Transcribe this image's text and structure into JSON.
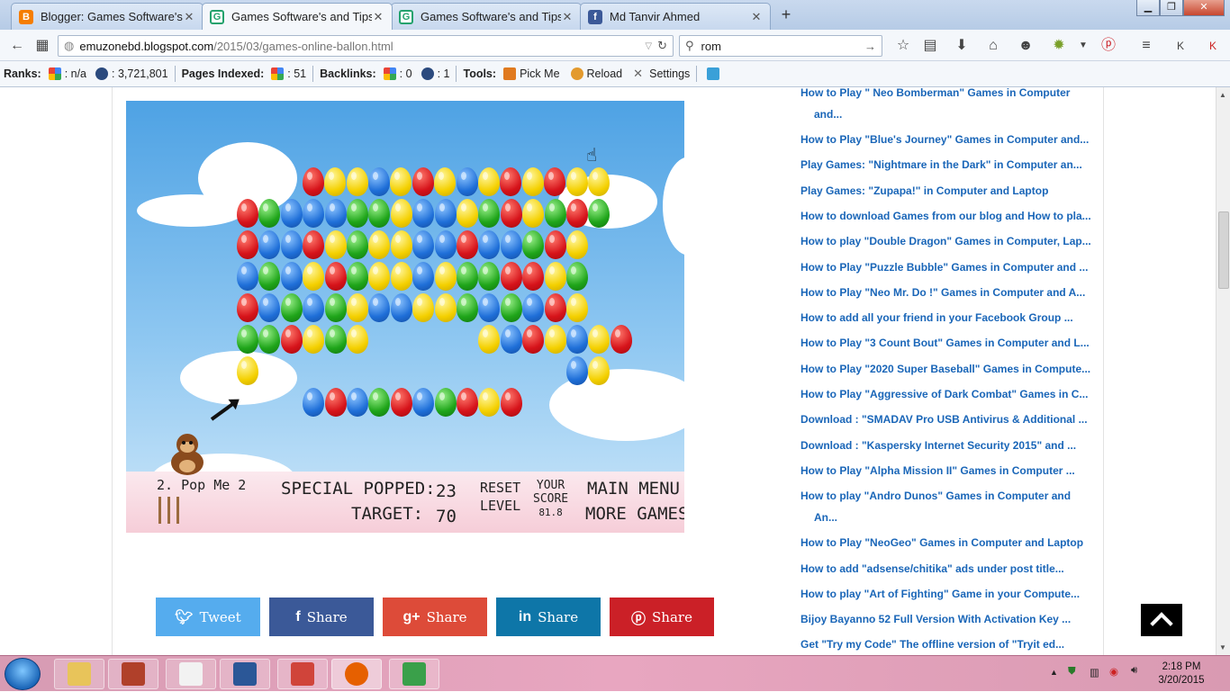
{
  "browser": {
    "tabs": [
      {
        "title": "Blogger: Games Software's ...",
        "icon": "blogger-icon",
        "color": "#f57d00",
        "active": false
      },
      {
        "title": "Games Software's and Tips...",
        "icon": "blog-g-icon",
        "color": "#23a26d",
        "active": true
      },
      {
        "title": "Games Software's and Tips...",
        "icon": "blog-g-icon",
        "color": "#23a26d",
        "active": false
      },
      {
        "title": "Md Tanvir Ahmed",
        "icon": "facebook-icon",
        "color": "#3b5998",
        "active": false
      }
    ],
    "url_host": "emuzonebd.blogspot.com",
    "url_path": "/2015/03/games-online-ballon.html",
    "search_value": "rom",
    "new_tab": "+"
  },
  "ranks": {
    "ranks_label": "Ranks:",
    "google_rank": ": n/a",
    "alexa_rank": ": 3,721,801",
    "pages_indexed_label": "Pages Indexed:",
    "pages_indexed": ": 51",
    "backlinks_label": "Backlinks:",
    "backlinks_google": ": 0",
    "backlinks_alexa": ": 1",
    "tools_label": "Tools:",
    "pick_me": "Pick Me",
    "reload": "Reload",
    "settings": "Settings"
  },
  "game": {
    "level_name": "2. Pop Me 2",
    "special_popped_label": "SPECIAL POPPED:",
    "special_popped": "23",
    "target_label": "TARGET:",
    "target": "70",
    "reset_line1": "RESET",
    "reset_line2": "LEVEL",
    "score_line1": "YOUR",
    "score_line2": "SCORE",
    "score_value": "81.8",
    "main_menu": "MAIN MENU",
    "more_games": "MORE GAMES",
    "balloon_rows": [
      "..RYYBYRYBYRYRYY.",
      "RGBBBGGYBBYGRYGRG",
      "RBBRYGYYBBRBBGRY",
      "BGBYRGYYBYGGRRYG",
      "RBGBGYBBYYGBGBRY",
      "GGRYGY.....YBRYBYR",
      "Y..............BY",
      "...BRBGRBGRYR...."
    ]
  },
  "share": [
    {
      "label": "Tweet",
      "icon": "twitter-icon",
      "glyph": "❧",
      "color": "#55acee"
    },
    {
      "label": "Share",
      "icon": "facebook-icon",
      "glyph": "f",
      "color": "#3b5998"
    },
    {
      "label": "Share",
      "icon": "google-plus-icon",
      "glyph": "g+",
      "color": "#dd4b39"
    },
    {
      "label": "Share",
      "icon": "linkedin-icon",
      "glyph": "in",
      "color": "#0e76a8"
    },
    {
      "label": "Share",
      "icon": "pinterest-icon",
      "glyph": "ⓟ",
      "color": "#cb2027"
    }
  ],
  "sidebar_links": [
    {
      "line1": "How to Play \" Neo Bomberman\" Games in Computer",
      "line2": "and..."
    },
    {
      "line1": "How to Play \"Blue's Journey\" Games in Computer and...",
      "line2": ""
    },
    {
      "line1": "Play Games: \"Nightmare in the Dark\" in Computer an...",
      "line2": ""
    },
    {
      "line1": "Play Games: \"Zupapa!\" in Computer and Laptop",
      "line2": ""
    },
    {
      "line1": "How to download Games from our blog and How to pla...",
      "line2": ""
    },
    {
      "line1": "How to play \"Double Dragon\" Games in Computer, Lap...",
      "line2": ""
    },
    {
      "line1": "How to Play \"Puzzle Bubble\" Games in Computer and ...",
      "line2": ""
    },
    {
      "line1": "How to Play \"Neo Mr. Do !\" Games in Computer and A...",
      "line2": ""
    },
    {
      "line1": "How to add all your friend in your Facebook Group ...",
      "line2": ""
    },
    {
      "line1": "How to Play \"3 Count Bout\" Games in Computer and L...",
      "line2": ""
    },
    {
      "line1": "How to Play \"2020 Super Baseball\" Games in Compute...",
      "line2": ""
    },
    {
      "line1": "How to Play \"Aggressive of Dark Combat\" Games in C...",
      "line2": ""
    },
    {
      "line1": "Download : \"SMADAV Pro USB Antivirus & Additional ...",
      "line2": ""
    },
    {
      "line1": "Download : \"Kaspersky Internet Security 2015\" and ...",
      "line2": ""
    },
    {
      "line1": "How to Play \"Alpha Mission II\" Games in Computer ...",
      "line2": ""
    },
    {
      "line1": "How to play \"Andro Dunos\" Games in Computer and",
      "line2": "An..."
    },
    {
      "line1": "How to Play \"NeoGeo\" Games in Computer and Laptop",
      "line2": ""
    },
    {
      "line1": "How to add \"adsense/chitika\" ads under post title...",
      "line2": ""
    },
    {
      "line1": "How to play \"Art of Fighting\" Game in your Compute...",
      "line2": ""
    },
    {
      "line1": "Bijoy Bayanno 52 Full Version With Activation Key ...",
      "line2": ""
    },
    {
      "line1": "Get \"Try my Code\" The offline version of \"Tryit ed...",
      "line2": ""
    }
  ],
  "taskbar": {
    "apps": [
      {
        "name": "explorer-icon",
        "color": "#e8c45a"
      },
      {
        "name": "nfs-game-icon",
        "color": "#b0402a"
      },
      {
        "name": "library-icon",
        "color": "#f2f2f2"
      },
      {
        "name": "word-icon",
        "color": "#2b5797"
      },
      {
        "name": "bijoy-icon",
        "color": "#d0443a"
      },
      {
        "name": "firefox-icon",
        "color": "#e66000"
      },
      {
        "name": "idm-icon",
        "color": "#3aa04a"
      }
    ],
    "time": "2:18 PM",
    "date": "3/20/2015"
  },
  "colors": {
    "link": "#1a66b8",
    "taskbar": "#e8a6c0"
  }
}
